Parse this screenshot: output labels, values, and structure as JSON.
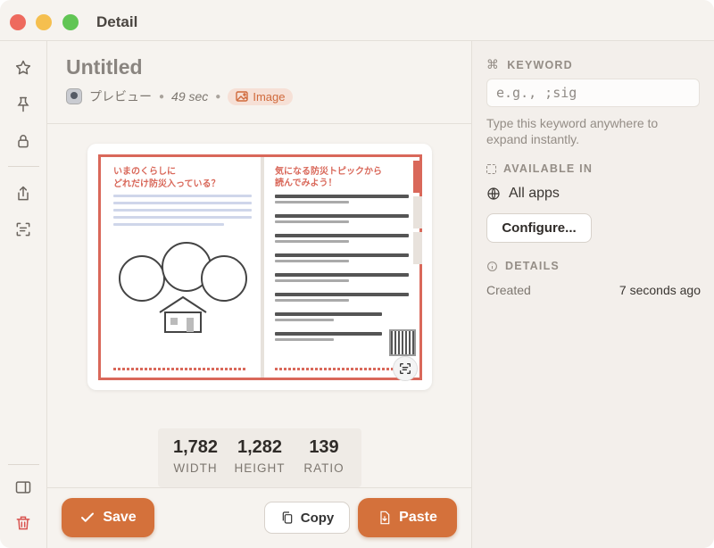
{
  "window": {
    "title": "Detail"
  },
  "toolbar": {
    "items": [
      {
        "name": "favorite",
        "icon": "star-icon"
      },
      {
        "name": "pin",
        "icon": "pin-icon"
      },
      {
        "name": "lock",
        "icon": "lock-icon"
      },
      {
        "name": "share",
        "icon": "share-icon"
      },
      {
        "name": "text-recognition",
        "icon": "text-scan-icon"
      },
      {
        "name": "toggle-sidebar",
        "icon": "sidebar-icon"
      },
      {
        "name": "delete",
        "icon": "trash-icon"
      }
    ]
  },
  "item": {
    "title": "Untitled",
    "source_app": "プレビュー",
    "duration": "49 sec",
    "type_label": "Image"
  },
  "preview": {
    "left_title_line1": "いまのくらしに",
    "left_title_line2": "どれだけ防災入っている？",
    "right_title_line1": "気になる防災トピックから",
    "right_title_line2": "読んでみよう！"
  },
  "dimensions": {
    "width_value": "1,782",
    "width_label": "WIDTH",
    "height_value": "1,282",
    "height_label": "HEIGHT",
    "ratio_value": "139",
    "ratio_label": "RATIO"
  },
  "actions": {
    "save_label": "Save",
    "copy_label": "Copy",
    "paste_label": "Paste"
  },
  "sidebar": {
    "keyword_heading": "KEYWORD",
    "keyword_placeholder": "e.g., ;sig",
    "keyword_hint": "Type this keyword anywhere to expand instantly.",
    "available_heading": "AVAILABLE IN",
    "available_value": "All apps",
    "configure_label": "Configure...",
    "details_heading": "DETAILS",
    "created_label": "Created",
    "created_value": "7 seconds ago"
  },
  "colors": {
    "accent": "#d4713b",
    "book_red": "#d9685a",
    "type_pill_bg": "#f6e0d6"
  }
}
